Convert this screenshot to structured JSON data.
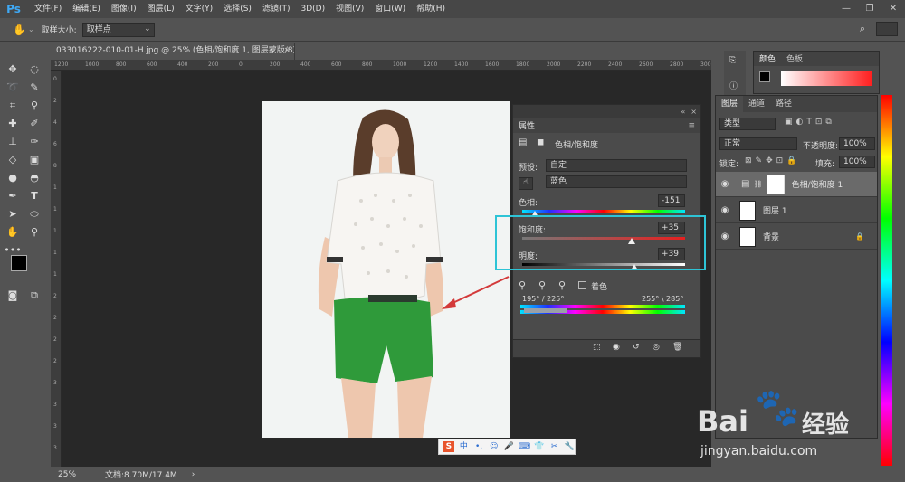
{
  "menubar": {
    "logo": "Ps",
    "items": [
      "文件(F)",
      "编辑(E)",
      "图像(I)",
      "图层(L)",
      "文字(Y)",
      "选择(S)",
      "滤镜(T)",
      "3D(D)",
      "视图(V)",
      "窗口(W)",
      "帮助(H)"
    ],
    "minimize": "—",
    "restore": "❐",
    "close": "✕"
  },
  "options": {
    "sample_size_label": "取样大小:",
    "sample_size_value": "取样点"
  },
  "document": {
    "tab_title": "033016222-010-01-H.jpg @ 25% (色相/饱和度 1, 图层蒙版/8) *",
    "close": "×",
    "ruler_h": [
      "1200",
      "1000",
      "800",
      "600",
      "400",
      "200",
      "0",
      "200",
      "400",
      "600",
      "800",
      "1000",
      "1200",
      "1400",
      "1600",
      "1800",
      "2000",
      "2200",
      "2400",
      "2600",
      "2800",
      "3000"
    ],
    "ruler_v": [
      "0",
      "2",
      "4",
      "6",
      "8",
      "1",
      "1",
      "1",
      "1",
      "1",
      "2",
      "2",
      "2",
      "2",
      "3",
      "3",
      "3",
      "3"
    ]
  },
  "status": {
    "zoom": "25%",
    "doc_info": "文档:8.70M/17.4M",
    "arrow": "›"
  },
  "properties": {
    "panel_title": "属性",
    "adjustment_name": "色相/饱和度",
    "preset_label": "预设:",
    "preset_value": "自定",
    "channel_value": "蓝色",
    "hue_label": "色相:",
    "hue_value": "-151",
    "saturation_label": "饱和度:",
    "saturation_value": "+35",
    "lightness_label": "明度:",
    "lightness_value": "+39",
    "colorize_label": "着色",
    "range_left": "195° / 225°",
    "range_right": "255° \\ 285°",
    "hue_fraction": 0.08,
    "saturation_fraction": 0.67,
    "lightness_fraction": 0.69
  },
  "color_panel": {
    "tabs": [
      "颜色",
      "色板"
    ]
  },
  "layers": {
    "tabs": [
      "图层",
      "通道",
      "路径"
    ],
    "filter_kind": "类型",
    "blend_mode": "正常",
    "opacity_label": "不透明度:",
    "opacity_value": "100%",
    "lock_label": "锁定:",
    "fill_label": "填充:",
    "fill_value": "100%",
    "items": [
      {
        "name": "色相/饱和度 1"
      },
      {
        "name": "图层 1"
      },
      {
        "name": "背景"
      }
    ],
    "lock_icon": "🔒"
  },
  "watermark": {
    "brand": "Bai",
    "brand2": "经验",
    "url": "jingyan.baidu.com"
  },
  "ime": {
    "items": [
      "S",
      "中",
      "•,",
      "☺",
      "🎤",
      "⌨",
      "👕",
      "✂",
      "🔧"
    ]
  },
  "colors": {
    "highlight_box": "#2ec4d6",
    "arrow": "#d33a3a",
    "accent": "#3fa9f5"
  }
}
